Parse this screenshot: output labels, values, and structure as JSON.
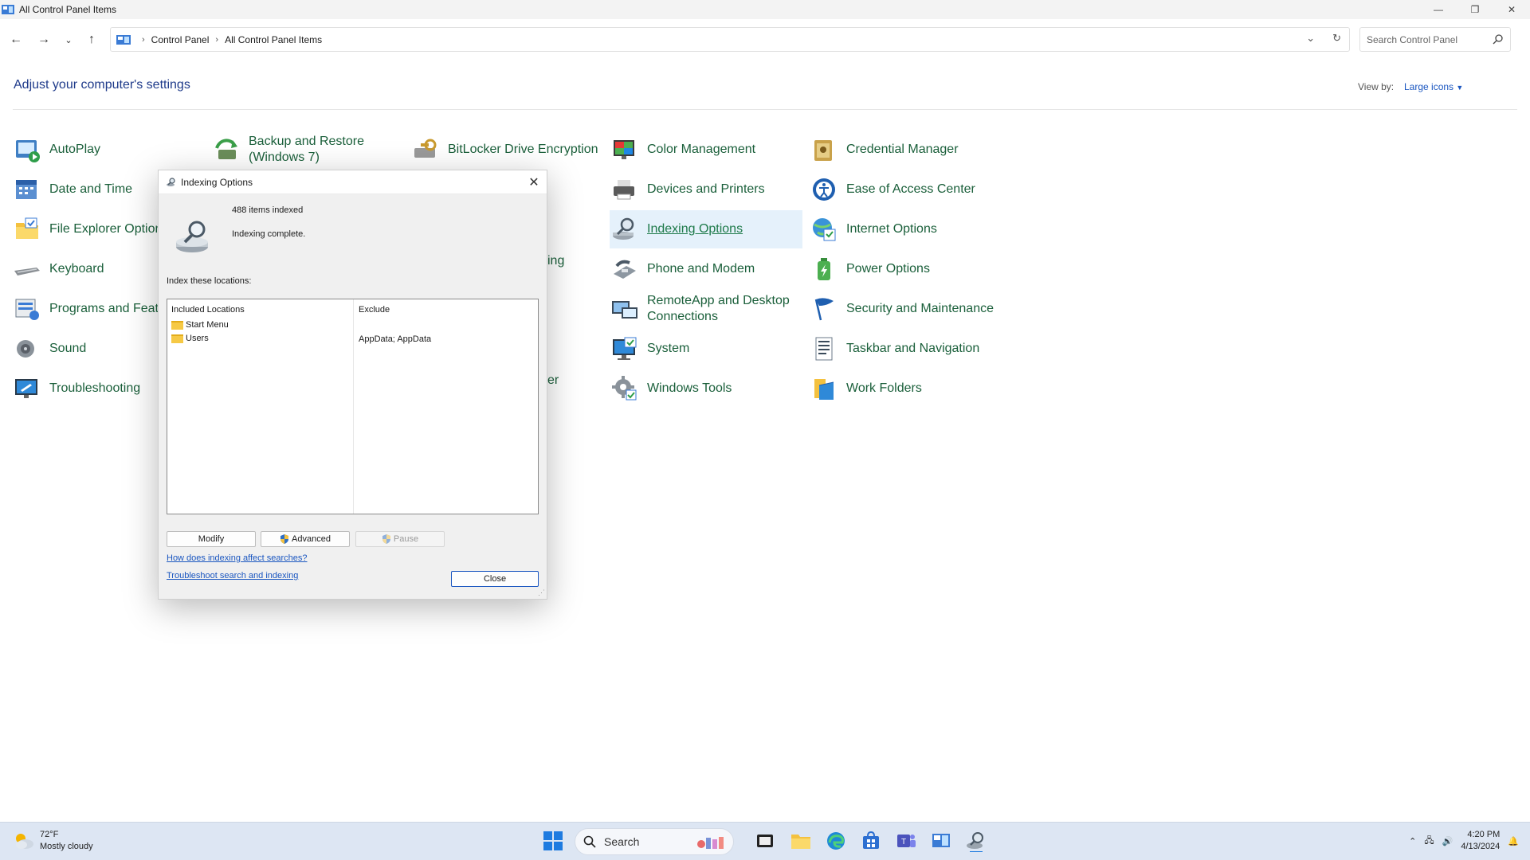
{
  "window": {
    "title": "All Control Panel Items",
    "controls": [
      "—",
      "❐",
      "✕"
    ]
  },
  "breadcrumb": {
    "root": "Control Panel",
    "current": "All Control Panel Items"
  },
  "search": {
    "placeholder": "Search Control Panel"
  },
  "header": {
    "title": "Adjust your computer's settings",
    "view_by_label": "View by:",
    "view_by_value": "Large icons"
  },
  "items": [
    {
      "label": "AutoPlay",
      "icon": "autoplay-icon"
    },
    {
      "label": "Backup and Restore\n(Windows 7)",
      "icon": "backup-icon"
    },
    {
      "label": "BitLocker Drive Encryption",
      "icon": "bitlocker-icon"
    },
    {
      "label": "Color Management",
      "icon": "color-management-icon"
    },
    {
      "label": "Credential Manager",
      "icon": "credential-manager-icon"
    },
    {
      "label": "Date and Time",
      "icon": "date-time-icon"
    },
    {
      "label": "Devices and Printers",
      "icon": "devices-printers-icon"
    },
    {
      "label": "Ease of Access Center",
      "icon": "ease-of-access-icon"
    },
    {
      "label": "File Explorer Options",
      "icon": "file-explorer-options-icon"
    },
    {
      "label": "Indexing Options",
      "icon": "indexing-options-icon"
    },
    {
      "label": "Internet Options",
      "icon": "internet-options-icon"
    },
    {
      "label": "Keyboard",
      "icon": "keyboard-icon"
    },
    {
      "label": "Phone and Modem",
      "icon": "phone-modem-icon"
    },
    {
      "label": "Power Options",
      "icon": "power-options-icon"
    },
    {
      "label": "Programs and Features",
      "icon": "programs-features-icon"
    },
    {
      "label": "RemoteApp and Desktop\nConnections",
      "icon": "remoteapp-icon"
    },
    {
      "label": "Security and Maintenance",
      "icon": "security-maintenance-icon"
    },
    {
      "label": "Sound",
      "icon": "sound-icon"
    },
    {
      "label": "System",
      "icon": "system-icon"
    },
    {
      "label": "Taskbar and Navigation",
      "icon": "taskbar-navigation-icon"
    },
    {
      "label": "Troubleshooting",
      "icon": "troubleshooting-icon"
    },
    {
      "label": "Windows Tools",
      "icon": "windows-tools-icon"
    },
    {
      "label": "Work Folders",
      "icon": "work-folders-icon"
    }
  ],
  "partial_items": [
    "ing",
    "er"
  ],
  "dialog": {
    "title": "Indexing Options",
    "items_indexed": "488 items indexed",
    "status": "Indexing complete.",
    "index_label": "Index these locations:",
    "columns": [
      "Included Locations",
      "Exclude"
    ],
    "locations": [
      {
        "name": "Start Menu",
        "exclude": ""
      },
      {
        "name": "Users",
        "exclude": "AppData; AppData"
      }
    ],
    "buttons": {
      "modify": "Modify",
      "advanced": "Advanced",
      "pause": "Pause",
      "close": "Close"
    },
    "links": [
      "How does indexing affect searches?",
      "Troubleshoot search and indexing"
    ]
  },
  "taskbar": {
    "weather_temp": "72°F",
    "weather_desc": "Mostly cloudy",
    "search_label": "Search",
    "time": "4:20 PM",
    "date": "4/13/2024"
  },
  "colors": {
    "link_green": "#1a5f3a",
    "title_blue": "#1e3a8a",
    "link_blue": "#1a56c0",
    "selection": "#e5f1fb"
  }
}
